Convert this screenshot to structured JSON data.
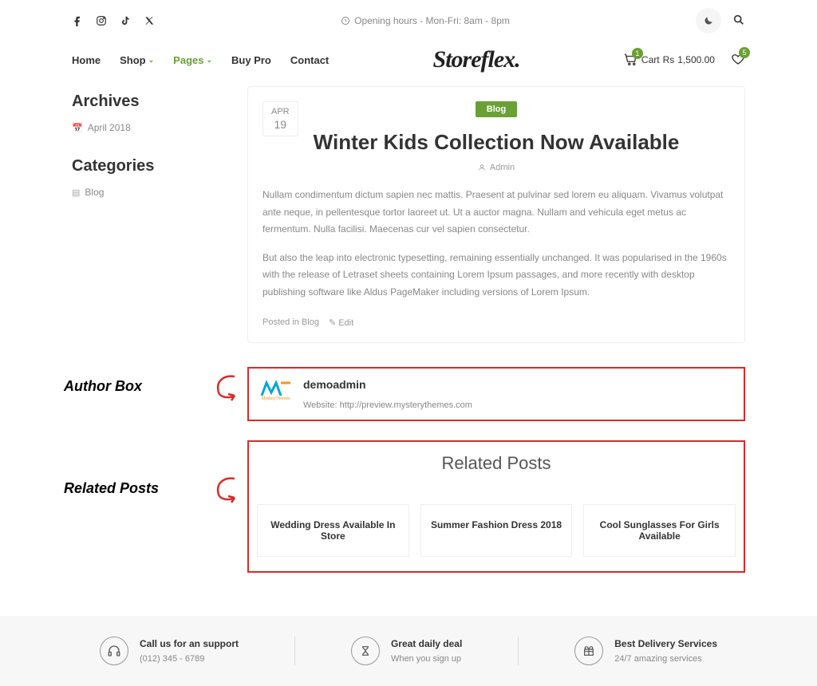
{
  "topbar": {
    "opening_hours": "Opening hours - Mon-Fri: 8am - 8pm"
  },
  "nav": {
    "items": [
      {
        "label": "Home",
        "active": false,
        "dropdown": false
      },
      {
        "label": "Shop",
        "active": false,
        "dropdown": true
      },
      {
        "label": "Pages",
        "active": true,
        "dropdown": true
      },
      {
        "label": "Buy Pro",
        "active": false,
        "dropdown": false
      },
      {
        "label": "Contact",
        "active": false,
        "dropdown": false
      }
    ],
    "logo": "Storeflex",
    "cart": {
      "label": "Cart",
      "currency": "Rs",
      "amount": "1,500.00",
      "count": "1"
    },
    "wishlist_count": "5"
  },
  "sidebar": {
    "archives_title": "Archives",
    "archives_item": "April 2018",
    "categories_title": "Categories",
    "categories_item": "Blog"
  },
  "article": {
    "date_month": "APR",
    "date_day": "19",
    "badge": "Blog",
    "title": "Winter Kids Collection Now Available",
    "author": "Admin",
    "p1": "Nullam condimentum dictum sapien nec mattis. Praesent at pulvinar sed lorem eu aliquam. Vivamus volutpat ante neque, in pellentesque tortor laoreet ut. Ut a auctor magna. Nullam and vehicula eget metus ac fermentum. Nulla facilisi. Maecenas cur vel sapien consectetur.",
    "p2": "But also the leap into electronic typesetting, remaining essentially unchanged. It was popularised in the 1960s with the release of Letraset sheets containing Lorem Ipsum passages, and more recently with desktop publishing software like Aldus PageMaker including versions of Lorem Ipsum.",
    "posted_in": "Posted in Blog",
    "edit": "Edit"
  },
  "annotations": {
    "author_box": "Author Box",
    "related_posts": "Related Posts"
  },
  "author_box": {
    "name": "demoadmin",
    "website_label": "Website:",
    "website_url": "http://preview.mysterythemes.com"
  },
  "related": {
    "title": "Related Posts",
    "items": [
      "Wedding Dress Available In Store",
      "Summer Fashion Dress 2018",
      "Cool Sunglasses For Girls Available"
    ]
  },
  "features": [
    {
      "title": "Call us for an support",
      "sub": "(012) 345 - 6789"
    },
    {
      "title": "Great daily deal",
      "sub": "When you sign up"
    },
    {
      "title": "Best Delivery Services",
      "sub": "24/7 amazing services"
    }
  ]
}
